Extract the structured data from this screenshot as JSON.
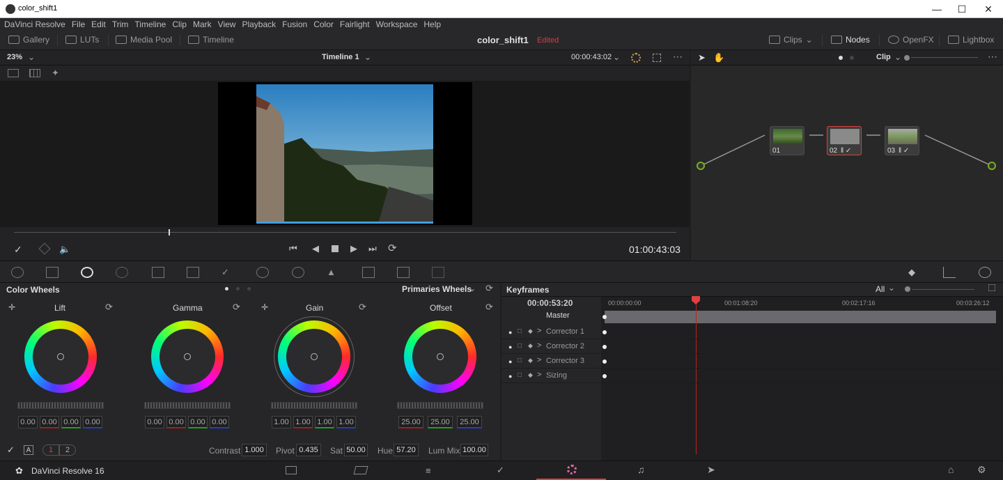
{
  "window": {
    "title": "color_shift1"
  },
  "menu": [
    "DaVinci Resolve",
    "File",
    "Edit",
    "Trim",
    "Timeline",
    "Clip",
    "Mark",
    "View",
    "Playback",
    "Fusion",
    "Color",
    "Fairlight",
    "Workspace",
    "Help"
  ],
  "toolbar": {
    "gallery": "Gallery",
    "luts": "LUTs",
    "media_pool": "Media Pool",
    "timeline": "Timeline",
    "project_name": "color_shift1",
    "edited": "Edited",
    "clips": "Clips",
    "nodes": "Nodes",
    "openfx": "OpenFX",
    "lightbox": "Lightbox"
  },
  "viewer": {
    "zoom": "23%",
    "timeline_name": "Timeline 1",
    "timecode_top": "00:00:43:02",
    "timecode": "01:00:43:03",
    "scrub_fraction": 0.233
  },
  "nodes": {
    "mode": "Clip",
    "items": [
      {
        "label": "01"
      },
      {
        "label": "02"
      },
      {
        "label": "03"
      }
    ]
  },
  "color_wheels": {
    "title": "Color Wheels",
    "mode": "Primaries Wheels",
    "wheels": [
      {
        "name": "Lift",
        "values": [
          "0.00",
          "0.00",
          "0.00",
          "0.00"
        ]
      },
      {
        "name": "Gamma",
        "values": [
          "0.00",
          "0.00",
          "0.00",
          "0.00"
        ]
      },
      {
        "name": "Gain",
        "values": [
          "1.00",
          "1.00",
          "1.00",
          "1.00"
        ]
      },
      {
        "name": "Offset",
        "values": [
          "25.00",
          "25.00",
          "25.00"
        ]
      }
    ],
    "page1": "1",
    "page2": "2",
    "contrast_label": "Contrast",
    "contrast": "1.000",
    "pivot_label": "Pivot",
    "pivot": "0.435",
    "sat_label": "Sat",
    "sat": "50.00",
    "hue_label": "Hue",
    "hue": "57.20",
    "lummix_label": "Lum Mix",
    "lummix": "100.00"
  },
  "keyframes": {
    "title": "Keyframes",
    "filter": "All",
    "current": "00:00:53:20",
    "ruler": [
      "00:00:00:00",
      "00:01:08:20",
      "00:02:17:16",
      "00:03:26:12"
    ],
    "rows": [
      "Master",
      "Corrector 1",
      "Corrector 2",
      "Corrector 3",
      "Sizing"
    ]
  },
  "bottom": {
    "app": "DaVinci Resolve 16"
  }
}
